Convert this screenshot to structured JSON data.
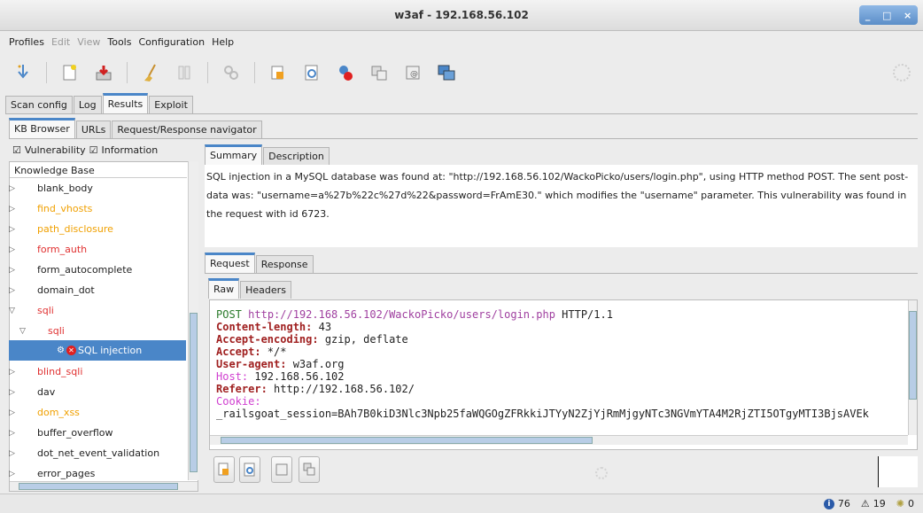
{
  "window": {
    "title": "w3af - 192.168.56.102",
    "buttons": [
      "_",
      "□",
      "×"
    ]
  },
  "menu": [
    {
      "label": "Profiles",
      "enabled": true
    },
    {
      "label": "Edit",
      "enabled": false
    },
    {
      "label": "View",
      "enabled": false
    },
    {
      "label": "Tools",
      "enabled": true
    },
    {
      "label": "Configuration",
      "enabled": true
    },
    {
      "label": "Help",
      "enabled": true
    }
  ],
  "main_tabs": [
    "Scan config",
    "Log",
    "Results",
    "Exploit"
  ],
  "result_tabs": [
    "KB Browser",
    "URLs",
    "Request/Response navigator"
  ],
  "filters": {
    "vulnerability": "Vulnerability",
    "information": "Information"
  },
  "kb": {
    "header": "Knowledge Base",
    "items": [
      {
        "label": "blank_body",
        "color": "#222",
        "arrow": "▷"
      },
      {
        "label": "find_vhosts",
        "color": "#f0a000",
        "arrow": "▷"
      },
      {
        "label": "path_disclosure",
        "color": "#f0a000",
        "arrow": "▷"
      },
      {
        "label": "form_auth",
        "color": "#e03030",
        "arrow": "▷"
      },
      {
        "label": "form_autocomplete",
        "color": "#222",
        "arrow": "▷"
      },
      {
        "label": "domain_dot",
        "color": "#222",
        "arrow": "▷"
      },
      {
        "label": "sqli",
        "color": "#e03030",
        "arrow": "▽"
      },
      {
        "label": "sqli",
        "color": "#e03030",
        "arrow": "▽"
      },
      {
        "label": "SQL injection",
        "color": "#fff",
        "arrow": ""
      },
      {
        "label": "blind_sqli",
        "color": "#e03030",
        "arrow": "▷"
      },
      {
        "label": "dav",
        "color": "#222",
        "arrow": "▷"
      },
      {
        "label": "dom_xss",
        "color": "#f0a000",
        "arrow": "▷"
      },
      {
        "label": "buffer_overflow",
        "color": "#222",
        "arrow": "▷"
      },
      {
        "label": "dot_net_event_validation",
        "color": "#222",
        "arrow": "▷"
      },
      {
        "label": "error_pages",
        "color": "#222",
        "arrow": "▷"
      }
    ]
  },
  "detail_tabs": [
    "Summary",
    "Description"
  ],
  "summary_text": "SQL injection in a MySQL database was found at: \"http://192.168.56.102/WackoPicko/users/login.php\", using HTTP method POST. The sent post-data was: \"username=a%27b%22c%27d%22&password=FrAmE30.\" which modifies the \"username\" parameter. This vulnerability was found in the request with id 6723.",
  "reqresp_tabs": [
    "Request",
    "Response"
  ],
  "raw_tabs": [
    "Raw",
    "Headers"
  ],
  "request": {
    "method": "POST",
    "url": "http://192.168.56.102/WackoPicko/users/login.php",
    "proto": "HTTP/1.1",
    "headers": [
      {
        "k": "Content-length:",
        "v": " 43"
      },
      {
        "k": "Accept-encoding:",
        "v": " gzip, deflate"
      },
      {
        "k": "Accept:",
        "v": " */*"
      },
      {
        "k": "User-agent:",
        "v": " w3af.org"
      },
      {
        "k": "Host:",
        "v": " 192.168.56.102"
      },
      {
        "k": "Referer:",
        "v": " http://192.168.56.102/"
      },
      {
        "k": "Cookie:",
        "v": ""
      }
    ],
    "cookie_line": "_railsgoat_session=BAh7B0kiD3Nlc3Npb25faWQGOgZFRkkiJTYyN2ZjYjRmMjgyNTc3NGVmYTA4M2RjZTI5OTgyMTI3BjsAVEk"
  },
  "status": {
    "info": "76",
    "warn": "19",
    "vuln": "0"
  },
  "colors": {
    "accent": "#4a86c8",
    "vuln_red": "#e03030",
    "info_orange": "#f0a000"
  }
}
